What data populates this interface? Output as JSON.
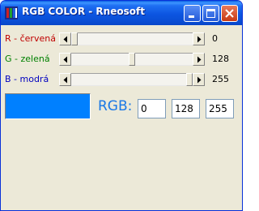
{
  "window": {
    "title": "RGB COLOR - Rneosoft",
    "buttons": [
      "minimize",
      "maximize",
      "close"
    ]
  },
  "sliders": [
    {
      "label": "R - červená",
      "value": "0",
      "level": 0,
      "label_color": "#c00000"
    },
    {
      "label": "G - zelená",
      "value": "128",
      "level": 128,
      "label_color": "#008000"
    },
    {
      "label": "B - modrá",
      "value": "255",
      "level": 255,
      "label_color": "#0000c0"
    }
  ],
  "slider_max": 255,
  "preview": {
    "color": "#0080ff"
  },
  "rgb_label": "RGB:",
  "inputs": {
    "r": "0",
    "g": "128",
    "b": "255"
  },
  "icons": {
    "app": "app-icon",
    "scroll_left": "left-arrow-icon",
    "scroll_right": "right-arrow-icon"
  }
}
